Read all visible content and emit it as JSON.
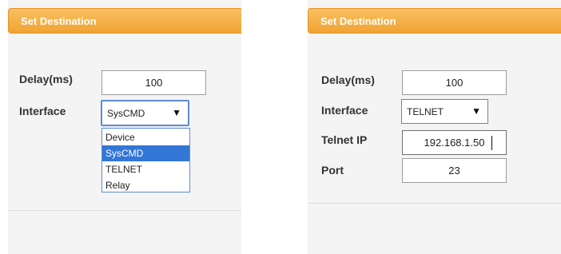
{
  "left_panel": {
    "title": "Set Destination",
    "delay_label": "Delay(ms)",
    "delay_value": "100",
    "interface_label": "Interface",
    "interface_value": "SysCMD",
    "dropdown_arrow": "▼",
    "dropdown_options": [
      "Device",
      "SysCMD",
      "TELNET",
      "Relay"
    ],
    "selected_option_index": 1
  },
  "right_panel": {
    "title": "Set Destination",
    "delay_label": "Delay(ms)",
    "delay_value": "100",
    "interface_label": "Interface",
    "interface_value": "TELNET",
    "dropdown_arrow": "▼",
    "telnet_ip_label": "Telnet IP",
    "telnet_ip_value": "192.168.1.50",
    "port_label": "Port",
    "port_value": "23"
  },
  "colors": {
    "header_orange": "#f0a332",
    "selection_blue": "#3277d6",
    "focus_blue": "#5a8bd6"
  }
}
